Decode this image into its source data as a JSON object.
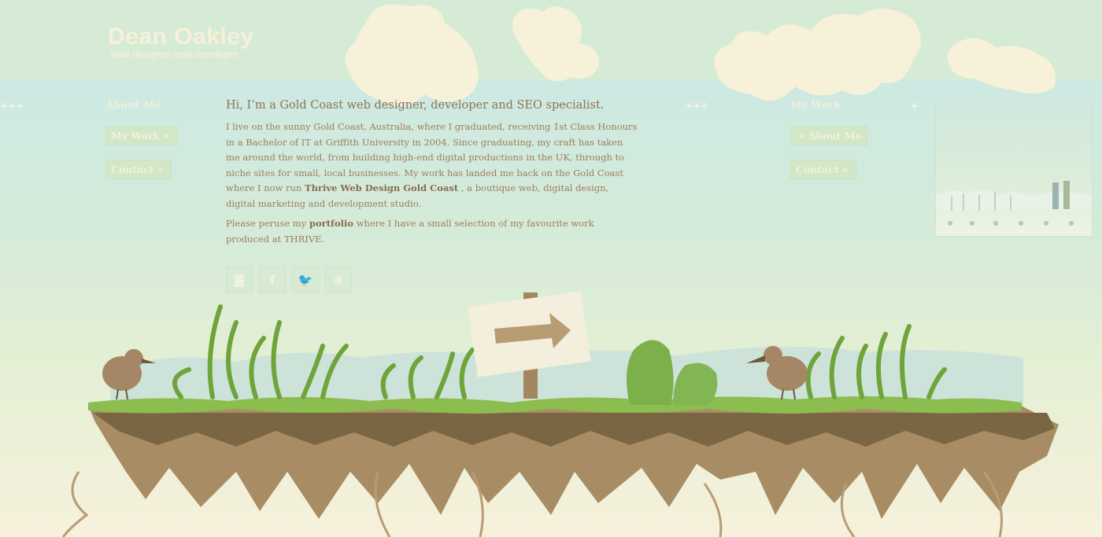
{
  "site": {
    "title": "Dean Oakley",
    "tagline": "Web designer and developer"
  },
  "nav_left": {
    "heading": "About Me",
    "buttons": [
      {
        "label": "My Work",
        "arrow": "»"
      },
      {
        "label": "Contact",
        "arrow": "»"
      }
    ]
  },
  "nav_right": {
    "heading": "My Work",
    "buttons": [
      {
        "label": "About Me",
        "arrow": "«"
      },
      {
        "label": "Contact",
        "arrow": "»"
      }
    ]
  },
  "decor": {
    "plus_left": "+++",
    "plus_mid": "+++",
    "plus_right": "+"
  },
  "intro": {
    "heading": "Hi, I’m a Gold Coast web designer, developer and SEO specialist.",
    "p1_a": "I live on the sunny Gold Coast, Australia, where I graduated, receiving 1st Class Honours in a Bachelor of IT at Griffith University in 2004. Since graduating, my craft has taken me around the world, from building high-end digital productions in the UK, through to niche sites for small, local businesses. My work has landed me back on the Gold Coast where I now run ",
    "p1_link": "Thrive Web Design Gold Coast",
    "p1_b": " , a boutique web, digital design, digital marketing and development studio.",
    "p2_a": "Please peruse my ",
    "p2_link": "portfolio",
    "p2_b": " where I have a small selection of my favourite work produced at THRIVE."
  },
  "social": [
    {
      "name": "instagram-icon",
      "glyph": "◙"
    },
    {
      "name": "facebook-icon",
      "glyph": "f"
    },
    {
      "name": "twitter-icon",
      "glyph": "🐦"
    },
    {
      "name": "dribbble-icon",
      "glyph": "⊛"
    }
  ],
  "colors": {
    "sky": "#d3ead7",
    "cloud": "#f8f1d9",
    "text": "#9e7e5a",
    "grass": "#8cbd4f",
    "earth": "#a88d64",
    "earth_dark": "#6e5a3a"
  }
}
